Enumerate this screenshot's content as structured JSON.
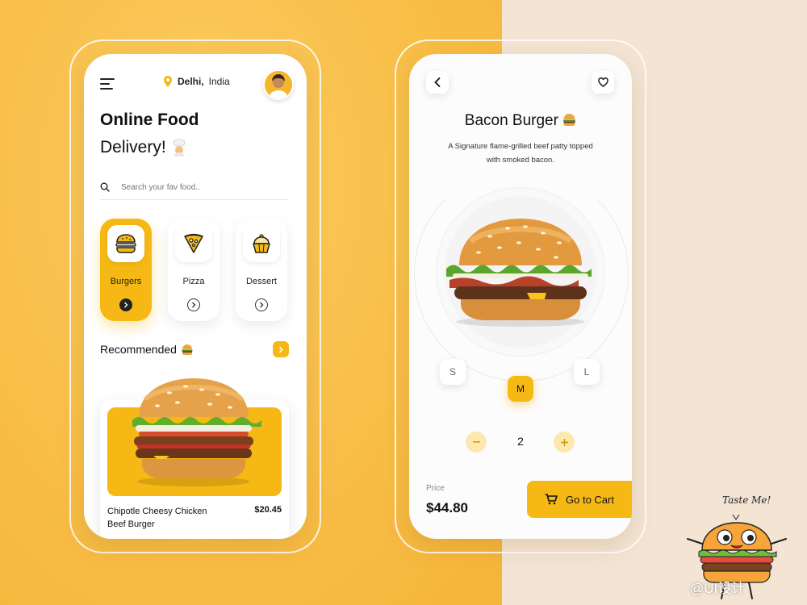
{
  "colors": {
    "accent": "#f5b814",
    "background_left": "#f8be47",
    "background_right": "#f3e4d4"
  },
  "home": {
    "location": {
      "city": "Delhi,",
      "country": "India"
    },
    "title_line1": "Online Food",
    "title_line2": "Delivery!",
    "search": {
      "placeholder": "Search your fav food.."
    },
    "categories": [
      {
        "label": "Burgers",
        "icon": "burger-icon",
        "active": true
      },
      {
        "label": "Pizza",
        "icon": "pizza-icon",
        "active": false
      },
      {
        "label": "Dessert",
        "icon": "cupcake-icon",
        "active": false
      }
    ],
    "recommended_label": "Recommended",
    "recommended_item": {
      "name": "Chipotle Cheesy Chicken Beef Burger",
      "price": "$20.45"
    }
  },
  "detail": {
    "title": "Bacon Burger",
    "description": "A Signature flame-grilled beef patty topped with smoked bacon.",
    "sizes": [
      "S",
      "M",
      "L"
    ],
    "selected_size": "M",
    "quantity": "2",
    "price_label": "Price",
    "price": "$44.80",
    "cart_button": "Go to Cart"
  },
  "mascot_caption": "Taste Me!",
  "watermark": "@UI设计"
}
